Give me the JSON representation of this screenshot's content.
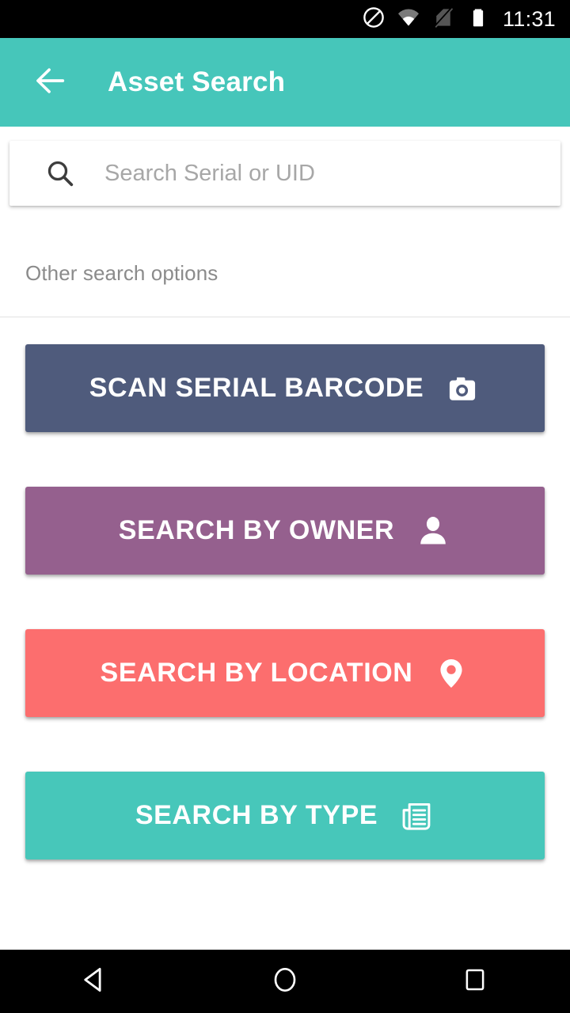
{
  "status_bar": {
    "time": "11:31",
    "icons": [
      "do-not-disturb-icon",
      "wifi-icon",
      "no-sim-icon",
      "battery-icon"
    ]
  },
  "app_bar": {
    "back_icon": "back-arrow-icon",
    "title": "Asset Search",
    "background_color": "#46c6ba"
  },
  "search": {
    "icon": "search-icon",
    "value": "",
    "placeholder": "Search Serial or UID"
  },
  "section": {
    "label": "Other search options"
  },
  "options": [
    {
      "label": "SCAN SERIAL BARCODE",
      "icon": "camera-icon",
      "color": "#4f5b7c"
    },
    {
      "label": "SEARCH BY OWNER",
      "icon": "person-icon",
      "color": "#95608e"
    },
    {
      "label": "SEARCH BY LOCATION",
      "icon": "map-pin-icon",
      "color": "#fc6e6e"
    },
    {
      "label": "SEARCH BY TYPE",
      "icon": "newspaper-icon",
      "color": "#47c7ba"
    }
  ],
  "nav_bar": {
    "back": "nav-back-icon",
    "home": "nav-home-icon",
    "recents": "nav-recents-icon"
  }
}
